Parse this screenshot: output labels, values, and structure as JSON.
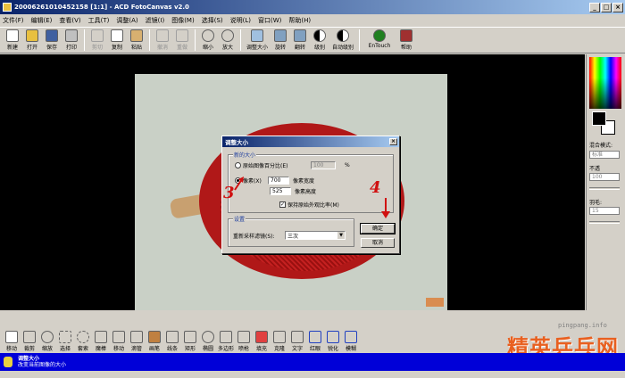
{
  "window": {
    "title": "20006261010452158 [1:1] - ACD FotoCanvas v2.0",
    "buttons": [
      "_",
      "□",
      "×"
    ]
  },
  "menu": [
    "文件(F)",
    "编辑(E)",
    "查看(V)",
    "工具(T)",
    "调整(A)",
    "滤镜(I)",
    "图像(M)",
    "选择(S)",
    "说明(L)",
    "窗口(W)",
    "帮助(H)"
  ],
  "toolbar": [
    {
      "label": "新建",
      "icon": "new-icon"
    },
    {
      "label": "打开",
      "icon": "open-icon"
    },
    {
      "label": "保存",
      "icon": "save-icon"
    },
    {
      "label": "打印",
      "icon": "print-icon"
    },
    {
      "label": "剪切",
      "icon": "cut-icon",
      "disabled": true
    },
    {
      "label": "复制",
      "icon": "copy-icon"
    },
    {
      "label": "粘贴",
      "icon": "paste-icon"
    },
    {
      "label": "撤消",
      "icon": "undo-icon",
      "disabled": true
    },
    {
      "label": "重做",
      "icon": "redo-icon",
      "disabled": true
    },
    {
      "label": "缩小",
      "icon": "zoom-out-icon"
    },
    {
      "label": "放大",
      "icon": "zoom-in-icon"
    },
    {
      "label": "调整大小",
      "icon": "resize-icon"
    },
    {
      "label": "旋转",
      "icon": "rotate-icon"
    },
    {
      "label": "翻转",
      "icon": "flip-icon"
    },
    {
      "label": "级别",
      "icon": "levels-icon"
    },
    {
      "label": "自动级别",
      "icon": "auto-levels-icon"
    },
    {
      "label": "EnTouch",
      "icon": "entouch-icon"
    },
    {
      "label": "帮助",
      "icon": "help-book-icon"
    }
  ],
  "palette": {
    "blend_label": "混合模式:",
    "blend_value": "标准",
    "opacity_label": "不透",
    "opacity_value": "100",
    "tolerance_label": "羽毛:",
    "tolerance_value": "15"
  },
  "dialog": {
    "title": "调整大小",
    "close": "×",
    "group_new_size": "新的大小",
    "percent_label": "原始图像百分比(E)",
    "percent_value": "100",
    "percent_unit": "%",
    "pixels_label": "像素(X)",
    "width_value": "700",
    "width_unit": "像素宽度",
    "height_value": "525",
    "height_unit": "像素高度",
    "keep_ratio_label": "保持原始外观比率(M)",
    "keep_ratio_checked": true,
    "group_settings": "设置",
    "resample_label": "重新采样滤镜(S):",
    "resample_value": "三次",
    "ok_label": "确定",
    "cancel_label": "取消"
  },
  "annotations": {
    "step3": "3",
    "step4": "4"
  },
  "tools": [
    {
      "label": "移动",
      "icon": "hand-icon",
      "selected": true
    },
    {
      "label": "裁剪",
      "icon": "crop-icon"
    },
    {
      "label": "缩放",
      "icon": "magnify-icon"
    },
    {
      "label": "选择",
      "icon": "rect-select-icon"
    },
    {
      "label": "套索",
      "icon": "lasso-icon"
    },
    {
      "label": "魔棒",
      "icon": "magic-wand-icon"
    },
    {
      "label": "移动",
      "icon": "move-icon"
    },
    {
      "label": "滴管",
      "icon": "eyedropper-icon"
    },
    {
      "label": "画笔",
      "icon": "brush-icon"
    },
    {
      "label": "线条",
      "icon": "line-icon"
    },
    {
      "label": "矩形",
      "icon": "rectangle-icon"
    },
    {
      "label": "椭圆",
      "icon": "ellipse-icon"
    },
    {
      "label": "多边形",
      "icon": "polygon-icon"
    },
    {
      "label": "喷枪",
      "icon": "airbrush-icon"
    },
    {
      "label": "填充",
      "icon": "fill-icon"
    },
    {
      "label": "克隆",
      "icon": "clone-icon"
    },
    {
      "label": "文字",
      "icon": "text-icon"
    },
    {
      "label": "红眼",
      "icon": "red-eye-icon"
    },
    {
      "label": "锐化",
      "icon": "sharpen-icon"
    },
    {
      "label": "模糊",
      "icon": "blur-icon"
    }
  ],
  "status": {
    "title": "调整大小",
    "text": "改变当前图像的大小"
  },
  "watermark": {
    "url": "pingpang.info",
    "logo": "精英乒乓网"
  },
  "colors": {
    "accent_blue": "#0a246a",
    "status_blue": "#0000d8",
    "annotation_red": "#d01010"
  }
}
